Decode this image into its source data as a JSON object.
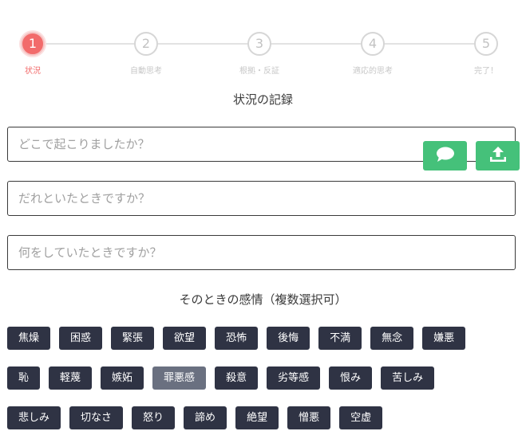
{
  "stepper": {
    "steps": [
      {
        "number": "1",
        "label": "状況",
        "active": true
      },
      {
        "number": "2",
        "label": "自動思考",
        "active": false
      },
      {
        "number": "3",
        "label": "根拠・反証",
        "active": false
      },
      {
        "number": "4",
        "label": "適応的思考",
        "active": false
      },
      {
        "number": "5",
        "label": "完了！",
        "active": false
      }
    ]
  },
  "section_title": "状況の記録",
  "inputs": {
    "where_placeholder": "どこで起こりましたか？",
    "who_placeholder": "だれといたときですか？",
    "what_placeholder": "何をしていたときですか？"
  },
  "actions": {
    "comment_icon": "speech-bubble-icon",
    "upload_icon": "upload-icon",
    "color": "#45c17a"
  },
  "emotions": {
    "title": "そのときの感情（複数選択可）",
    "rows": [
      [
        {
          "label": "焦燥",
          "selected": false
        },
        {
          "label": "困惑",
          "selected": false
        },
        {
          "label": "緊張",
          "selected": false
        },
        {
          "label": "欲望",
          "selected": false
        },
        {
          "label": "恐怖",
          "selected": false
        },
        {
          "label": "後悔",
          "selected": false
        },
        {
          "label": "不満",
          "selected": false
        },
        {
          "label": "無念",
          "selected": false
        },
        {
          "label": "嫌悪",
          "selected": false
        }
      ],
      [
        {
          "label": "恥",
          "selected": false
        },
        {
          "label": "軽蔑",
          "selected": false
        },
        {
          "label": "嫉妬",
          "selected": false
        },
        {
          "label": "罪悪感",
          "selected": true
        },
        {
          "label": "殺意",
          "selected": false
        },
        {
          "label": "劣等感",
          "selected": false
        },
        {
          "label": "恨み",
          "selected": false
        },
        {
          "label": "苦しみ",
          "selected": false
        }
      ],
      [
        {
          "label": "悲しみ",
          "selected": false
        },
        {
          "label": "切なさ",
          "selected": false
        },
        {
          "label": "怒り",
          "selected": false
        },
        {
          "label": "諦め",
          "selected": false
        },
        {
          "label": "絶望",
          "selected": false
        },
        {
          "label": "憎悪",
          "selected": false
        },
        {
          "label": "空虚",
          "selected": false
        }
      ]
    ]
  },
  "colors": {
    "active_step": "#f26b6b",
    "chip": "#2f3344",
    "chip_selected": "#6a7080"
  }
}
